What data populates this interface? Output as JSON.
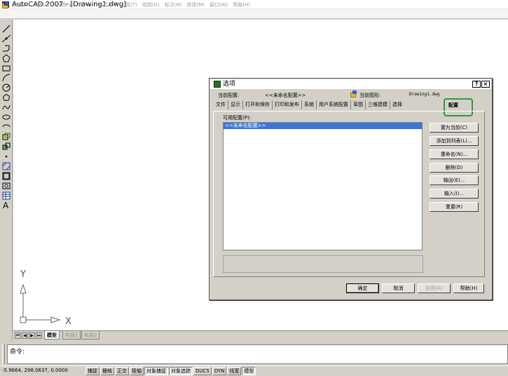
{
  "window": {
    "title": "AutoCAD 2007 - [Drawing1.dwg]"
  },
  "menu": [
    "文件(F)",
    "编辑(E)",
    "视图(V)",
    "插入(I)",
    "格式(O)",
    "工具(T)",
    "绘图(D)",
    "标注(N)",
    "修改(M)",
    "窗口(W)",
    "帮助(H)"
  ],
  "canvas": {
    "ucs_y": "Y",
    "ucs_x": "X"
  },
  "layout_tabs": {
    "nav": [
      "⏮",
      "◀",
      "▶",
      "⏭"
    ],
    "tabs": [
      "模型",
      "布局1",
      "布局2"
    ]
  },
  "command": {
    "prompt": "命令:"
  },
  "status": {
    "coords": "-5.9664,  298.0637, 0.0000",
    "toggles": [
      "捕捉",
      "栅格",
      "正交",
      "极轴",
      "对象捕捉",
      "对象追踪",
      "DUCS",
      "DYN",
      "线宽",
      "模型"
    ]
  },
  "dialog": {
    "title": "选项",
    "help_btn": "?",
    "close_btn": "×",
    "current_profile_label": "当前配置:",
    "current_profile_value": "<<未命名配置>>",
    "current_drawing_label": "当前图形:",
    "current_drawing_value": "Drawing1.dwg",
    "tabs": [
      "文件",
      "显示",
      "打开和保存",
      "打印和发布",
      "系统",
      "用户系统配置",
      "草图",
      "三维建模",
      "选择"
    ],
    "active_tab": "配置",
    "available_label": "可用配置(P):",
    "profiles": [
      "<<未命名配置>>"
    ],
    "side_buttons": [
      "置为当前(C)",
      "添加到列表(L)...",
      "重命名(N)...",
      "删除(D)",
      "输出(E)...",
      "输入(I)...",
      "重置(R)"
    ],
    "ok": "确定",
    "cancel": "取消",
    "apply": "应用(A)",
    "help": "帮助(H)"
  }
}
